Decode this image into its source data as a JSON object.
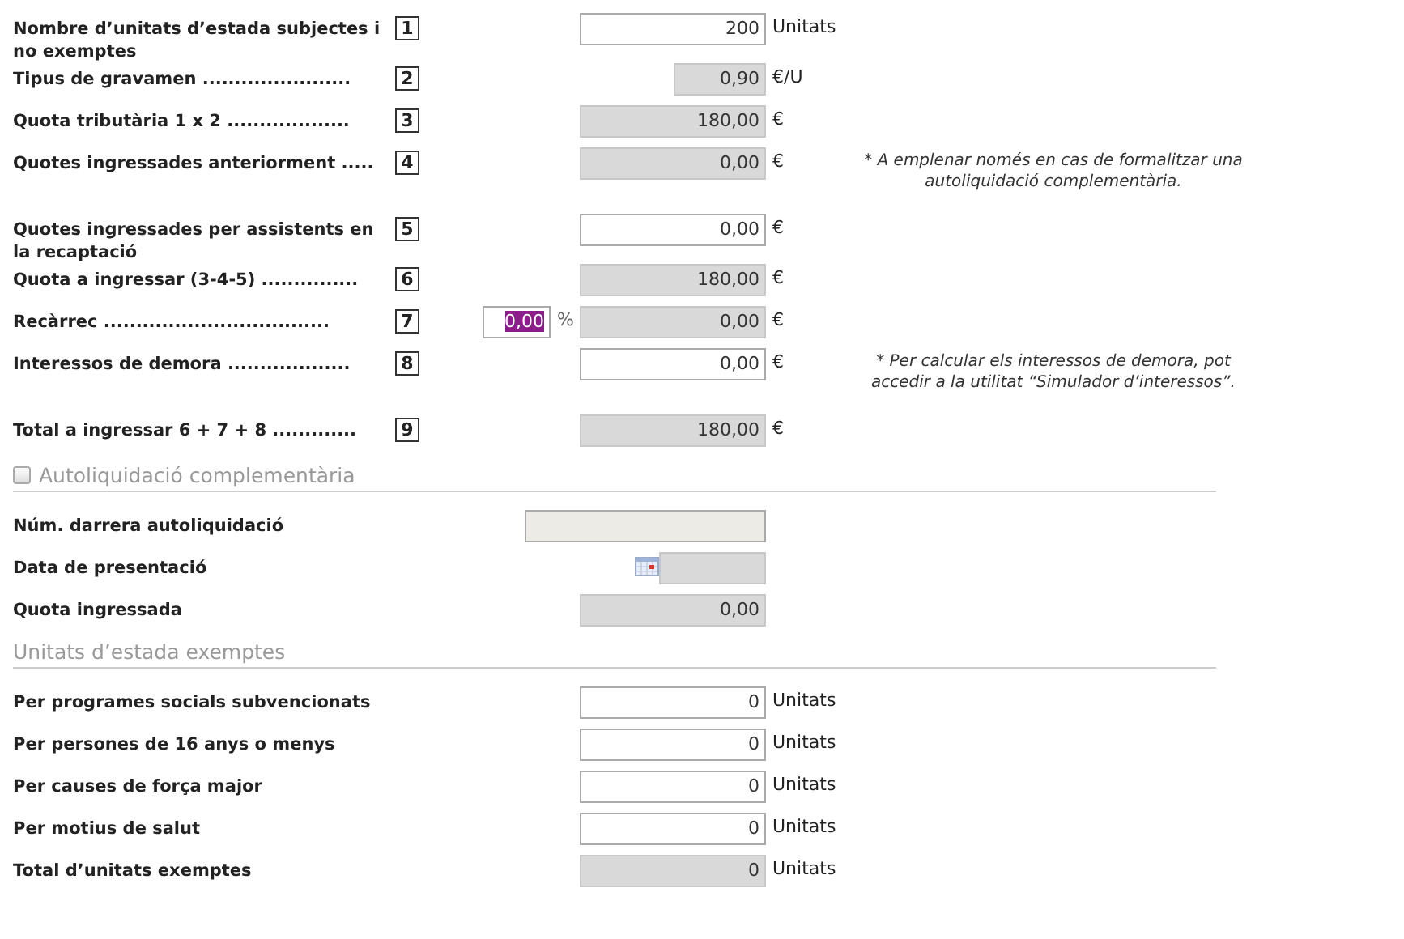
{
  "rows": [
    {
      "kind": "amount",
      "label": "Nombre d’unitats d’estada subjectes i no exemptes",
      "number": "1",
      "field": {
        "value": "200",
        "readonly": false,
        "disabled": false
      },
      "unit": "Unitats"
    },
    {
      "kind": "rate",
      "label": "Tipus de gravamen .......................",
      "number": "2",
      "field": {
        "value": "0,90",
        "readonly": true,
        "disabled": false
      },
      "unit": "€/U"
    },
    {
      "kind": "amount",
      "label": "Quota tributària 1 x 2 ...................",
      "number": "3",
      "field": {
        "value": "180,00",
        "readonly": true,
        "disabled": false
      },
      "unit": "€"
    },
    {
      "kind": "amount",
      "label": "Quotes ingressades anteriorment .....",
      "number": "4",
      "field": {
        "value": "0,00",
        "readonly": true,
        "disabled": false
      },
      "unit": "€",
      "note": "* A emplenar només en cas de formalitzar una autoliquidació complementària."
    },
    {
      "kind": "amount",
      "label": "Quotes ingressades per assistents en la recaptació",
      "number": "5",
      "field": {
        "value": "0,00",
        "readonly": false,
        "disabled": false
      },
      "unit": "€"
    },
    {
      "kind": "amount",
      "label": "Quota a ingressar (3-4-5) ...............",
      "number": "6",
      "field": {
        "value": "180,00",
        "readonly": true,
        "disabled": false
      },
      "unit": "€"
    },
    {
      "kind": "surcharge",
      "label": "Recàrrec ...................................",
      "number": "7",
      "percent": {
        "value": "0,00",
        "selected": true,
        "unit": "%"
      },
      "field": {
        "value": "0,00",
        "readonly": true,
        "disabled": false
      },
      "unit": "€"
    },
    {
      "kind": "amount",
      "label": "Interessos de demora ...................",
      "number": "8",
      "field": {
        "value": "0,00",
        "readonly": false,
        "disabled": false
      },
      "unit": "€",
      "note": "* Per calcular els interessos de demora, pot accedir a la utilitat “Simulador d’interessos”."
    },
    {
      "kind": "amount",
      "label": "Total a ingressar 6 + 7 + 8 .............",
      "number": "9",
      "field": {
        "value": "180,00",
        "readonly": true,
        "disabled": false
      },
      "unit": "€"
    }
  ],
  "complementary": {
    "label": "Autoliquidació complementària",
    "checked": false,
    "rows": [
      {
        "kind": "text",
        "label": "Núm. darrera autoliquidació",
        "field": {
          "readonly": false,
          "disabled": true
        }
      },
      {
        "kind": "date",
        "label": "Data de presentació",
        "field": {
          "readonly": true,
          "disabled": false
        }
      },
      {
        "kind": "amount",
        "label": "Quota ingressada",
        "field": {
          "value": "0,00",
          "readonly": true,
          "disabled": false
        }
      }
    ]
  },
  "exempt": {
    "title": "Unitats d’estada exemptes",
    "rows": [
      {
        "kind": "amount",
        "label": "Per programes socials subvencionats",
        "field": {
          "value": "0",
          "readonly": false,
          "disabled": false
        },
        "unit": "Unitats"
      },
      {
        "kind": "amount",
        "label": "Per persones de 16 anys o menys",
        "field": {
          "value": "0",
          "readonly": false,
          "disabled": false
        },
        "unit": "Unitats"
      },
      {
        "kind": "amount",
        "label": "Per causes de força major",
        "field": {
          "value": "0",
          "readonly": false,
          "disabled": false
        },
        "unit": "Unitats"
      },
      {
        "kind": "amount",
        "label": "Per motius de salut",
        "field": {
          "value": "0",
          "readonly": false,
          "disabled": false
        },
        "unit": "Unitats"
      },
      {
        "kind": "amount",
        "label": "Total d’unitats exemptes",
        "field": {
          "value": "0",
          "readonly": true,
          "disabled": false
        },
        "unit": "Unitats"
      }
    ]
  }
}
